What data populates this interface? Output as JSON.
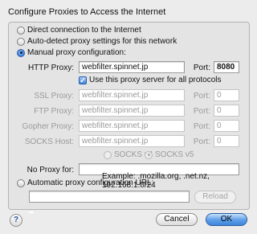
{
  "dialog": {
    "title": "Configure Proxies to Access the Internet"
  },
  "options": {
    "direct": "Direct connection to the Internet",
    "autodetect": "Auto-detect proxy settings for this network",
    "manual": "Manual proxy configuration:",
    "auto_url": "Automatic proxy configuration URL:"
  },
  "proxies": {
    "port_label": "Port:",
    "http": {
      "label": "HTTP Proxy:",
      "host": "webfilter.spinnet.jp",
      "port": "8080"
    },
    "use_all_label": "Use this proxy server for all protocols",
    "ssl": {
      "label": "SSL Proxy:",
      "host": "webfilter.spinnet.jp",
      "port": "0"
    },
    "ftp": {
      "label": "FTP Proxy:",
      "host": "webfilter.spinnet.jp",
      "port": "0"
    },
    "gopher": {
      "label": "Gopher Proxy:",
      "host": "webfilter.spinnet.jp",
      "port": "0"
    },
    "socks": {
      "label": "SOCKS Host:",
      "host": "webfilter.spinnet.jp",
      "port": "0"
    },
    "socks_v4": "SOCKS v4",
    "socks_v5": "SOCKS v5"
  },
  "no_proxy": {
    "label": "No Proxy for:",
    "value": "",
    "example": "Example: .mozilla.org, .net.nz, 192.168.1.0/24"
  },
  "auto_config": {
    "url_value": "",
    "reload_label": "Reload"
  },
  "buttons": {
    "help": "?",
    "cancel": "Cancel",
    "ok": "OK"
  },
  "colors": {
    "accent": "#3f86dc",
    "window_bg": "#ececec"
  }
}
